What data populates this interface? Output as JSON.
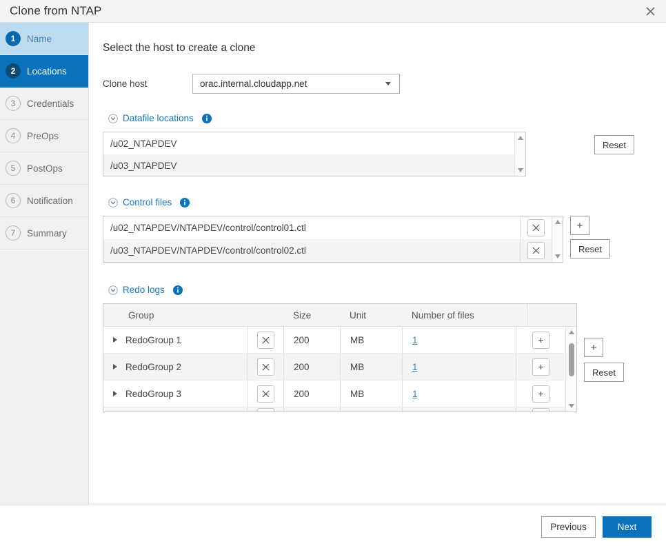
{
  "window": {
    "title": "Clone from NTAP",
    "close_icon": "close-icon"
  },
  "sidebar": {
    "steps": [
      {
        "num": "1",
        "label": "Name",
        "state": "done"
      },
      {
        "num": "2",
        "label": "Locations",
        "state": "active"
      },
      {
        "num": "3",
        "label": "Credentials",
        "state": "idle"
      },
      {
        "num": "4",
        "label": "PreOps",
        "state": "idle"
      },
      {
        "num": "5",
        "label": "PostOps",
        "state": "idle"
      },
      {
        "num": "6",
        "label": "Notification",
        "state": "idle"
      },
      {
        "num": "7",
        "label": "Summary",
        "state": "idle"
      }
    ]
  },
  "panel": {
    "title": "Select the host to create a clone",
    "host": {
      "label": "Clone host",
      "selected": "orac.internal.cloudapp.net",
      "caret_icon": "chevron-down-icon"
    }
  },
  "datafile_locations": {
    "title": "Datafile locations",
    "collapse_icon": "chevron-down-circle-icon",
    "info_icon": "info-icon",
    "rows": [
      {
        "path": "/u02_NTAPDEV"
      },
      {
        "path": "/u03_NTAPDEV"
      }
    ],
    "reset_label": "Reset"
  },
  "control_files": {
    "title": "Control files",
    "collapse_icon": "chevron-down-circle-icon",
    "info_icon": "info-icon",
    "rows": [
      {
        "path": "/u02_NTAPDEV/NTAPDEV/control/control01.ctl",
        "delete_label": "×"
      },
      {
        "path": "/u03_NTAPDEV/NTAPDEV/control/control02.ctl",
        "delete_label": "×"
      }
    ],
    "add_label": "+",
    "reset_label": "Reset"
  },
  "redo_logs": {
    "title": "Redo logs",
    "collapse_icon": "chevron-down-circle-icon",
    "info_icon": "info-icon",
    "columns": {
      "group": "Group",
      "size": "Size",
      "unit": "Unit",
      "files": "Number of files"
    },
    "rows": [
      {
        "group": "RedoGroup 1",
        "size": "200",
        "unit": "MB",
        "files": "1",
        "delete_label": "×",
        "add_label": "+"
      },
      {
        "group": "RedoGroup 2",
        "size": "200",
        "unit": "MB",
        "files": "1",
        "delete_label": "×",
        "add_label": "+"
      },
      {
        "group": "RedoGroup 3",
        "size": "200",
        "unit": "MB",
        "files": "1",
        "delete_label": "×",
        "add_label": "+"
      }
    ],
    "add_label": "+",
    "reset_label": "Reset"
  },
  "footer": {
    "previous_label": "Previous",
    "next_label": "Next"
  },
  "colors": {
    "accent": "#0a72bd",
    "link": "#3d7fc1",
    "step_done_bg": "#bddcf0",
    "section_title": "#1378c4"
  }
}
